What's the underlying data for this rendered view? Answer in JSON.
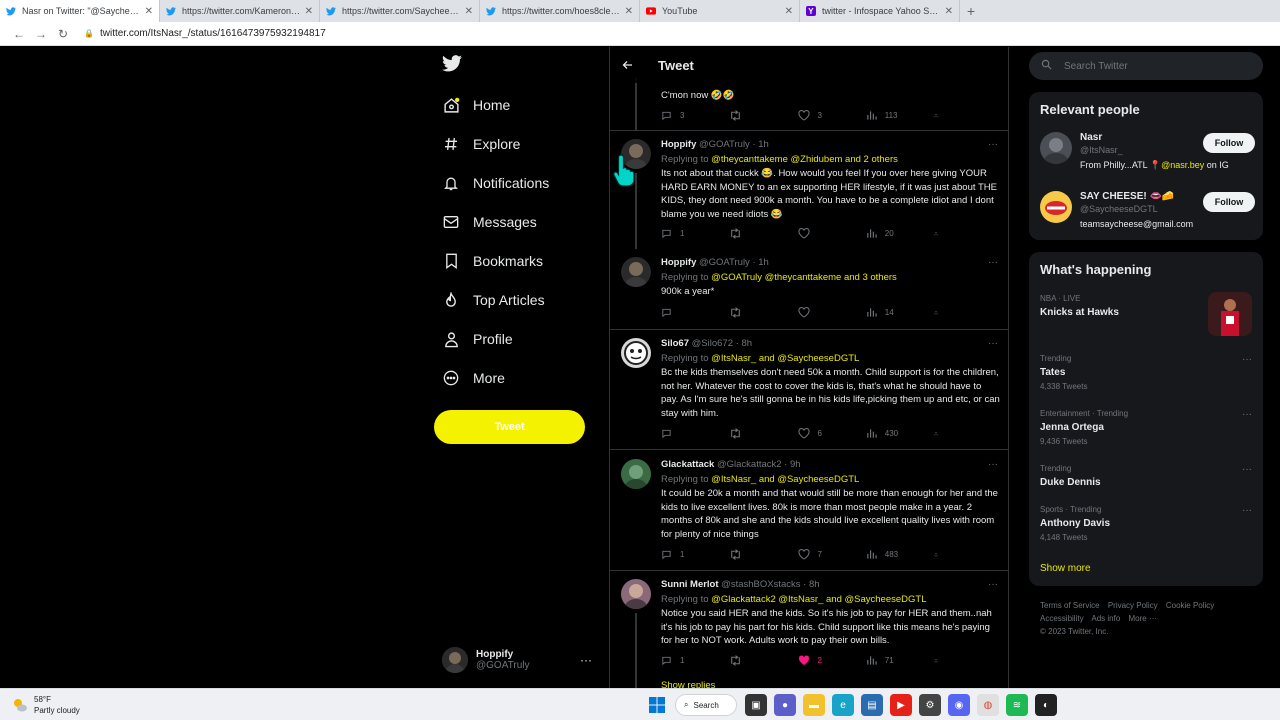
{
  "browser": {
    "tabs": [
      {
        "title": "Nasr on Twitter: \"@SaycheeseDGTL",
        "icon": "twitter-icon",
        "active": true
      },
      {
        "title": "https://twitter.com/KameronBen",
        "icon": "twitter-icon",
        "active": false
      },
      {
        "title": "https://twitter.com/SaycheeseDG",
        "icon": "twitter-icon",
        "active": false
      },
      {
        "title": "https://twitter.com/hoes8cleve/s",
        "icon": "twitter-icon",
        "active": false
      },
      {
        "title": "YouTube",
        "icon": "youtube-icon",
        "active": false
      },
      {
        "title": "twitter - Infospace Yahoo Search",
        "icon": "yahoo-icon",
        "active": false
      }
    ],
    "url": "twitter.com/ItsNasr_/status/1616473975932194817"
  },
  "nav": {
    "items": [
      {
        "label": "Home",
        "icon": "home-icon"
      },
      {
        "label": "Explore",
        "icon": "hashtag-icon"
      },
      {
        "label": "Notifications",
        "icon": "bell-icon"
      },
      {
        "label": "Messages",
        "icon": "envelope-icon"
      },
      {
        "label": "Bookmarks",
        "icon": "bookmark-icon"
      },
      {
        "label": "Top Articles",
        "icon": "fire-icon"
      },
      {
        "label": "Profile",
        "icon": "person-icon"
      },
      {
        "label": "More",
        "icon": "more-circle-icon"
      }
    ],
    "tweet_button": "Tweet",
    "account": {
      "name": "Hoppify",
      "handle": "@GOATruly"
    }
  },
  "header": {
    "title": "Tweet"
  },
  "tweets": [
    {
      "partial_text": "C'mon now 🤣🤣",
      "stats": {
        "replies": "3",
        "retweets": "",
        "likes": "3",
        "views": "113"
      }
    },
    {
      "name": "Hoppify",
      "handle": "@GOATruly",
      "time": "1h",
      "replying_label": "Replying to",
      "replying_to": "@theycanttakeme @Zhidubem and 2 others",
      "text": "Its not about that cuckk 😂. How would you feel If you over here giving YOUR HARD EARN MONEY to an ex supporting HER lifestyle, if it was just about THE KIDS, they dont need 900k a month. You have to be a complete idiot and I dont blame you we need idiots 😂",
      "stats": {
        "replies": "1",
        "retweets": "",
        "likes": "",
        "views": "20"
      }
    },
    {
      "name": "Hoppify",
      "handle": "@GOATruly",
      "time": "1h",
      "replying_label": "Replying to",
      "replying_to": "@GOATruly @theycanttakeme and 3 others",
      "text": "900k a year*",
      "stats": {
        "replies": "",
        "retweets": "",
        "likes": "",
        "views": "14"
      }
    },
    {
      "name": "Silo67",
      "handle": "@Silo672",
      "time": "8h",
      "replying_label": "Replying to",
      "replying_to": "@ItsNasr_ and @SaycheeseDGTL",
      "text": "Bc the kids themselves don't need 50k a month. Child support is for the children, not her. Whatever the cost to cover the kids is, that's what he should have to pay. As I'm sure he's still gonna be in his kids life,picking them up and etc, or can stay with him.",
      "stats": {
        "replies": "",
        "retweets": "",
        "likes": "6",
        "views": "430"
      }
    },
    {
      "name": "Glackattack",
      "handle": "@Glackattack2",
      "time": "9h",
      "replying_label": "Replying to",
      "replying_to": "@ItsNasr_ and @SaycheeseDGTL",
      "text": "It could be 20k a month and that would still be more than enough for her and the kids to live excellent lives. 80k is more than most people make in a year. 2 months of 80k and she and the kids should live excellent quality lives with room for plenty of nice things",
      "stats": {
        "replies": "1",
        "retweets": "",
        "likes": "7",
        "views": "483"
      }
    },
    {
      "name": "Sunni Merlot",
      "handle": "@stashBOXstacks",
      "time": "8h",
      "replying_label": "Replying to",
      "replying_to": "@Glackattack2 @ItsNasr_ and @SaycheeseDGTL",
      "text": "Notice you said HER and the kids. So it's his job to pay for HER and them..nah it's his job to pay his part for his kids. Child support like this means he's paying for her to NOT work. Adults work to pay their own bills.",
      "stats": {
        "replies": "1",
        "retweets": "",
        "likes": "2",
        "views": "71"
      }
    }
  ],
  "show_replies": "Show replies",
  "right": {
    "search_placeholder": "Search Twitter",
    "relevant_title": "Relevant people",
    "people": [
      {
        "name": "Nasr",
        "handle": "@ItsNasr_",
        "bio_pre": "From Philly...ATL 📍",
        "bio_link": "@nasr.bey",
        "bio_post": " on IG",
        "follow": "Follow"
      },
      {
        "name": "SAY CHEESE! 👄🧀",
        "handle": "@SaycheeseDGTL",
        "bio_pre": "teamsaycheese@gmail.com",
        "bio_link": "",
        "bio_post": "",
        "follow": "Follow"
      }
    ],
    "happening_title": "What's happening",
    "trends": [
      {
        "context": "NBA · LIVE",
        "name": "Knicks at Hawks",
        "count": ""
      },
      {
        "context": "Trending",
        "name": "Tates",
        "count": "4,338 Tweets"
      },
      {
        "context": "Entertainment · Trending",
        "name": "Jenna Ortega",
        "count": "9,436 Tweets"
      },
      {
        "context": "Trending",
        "name": "Duke Dennis",
        "count": ""
      },
      {
        "context": "Sports · Trending",
        "name": "Anthony Davis",
        "count": "4,148 Tweets"
      }
    ],
    "show_more": "Show more",
    "footer": [
      "Terms of Service",
      "Privacy Policy",
      "Cookie Policy",
      "Accessibility",
      "Ads info",
      "More ···",
      "© 2023 Twitter, Inc."
    ]
  },
  "taskbar": {
    "temp": "58°F",
    "weather": "Partly cloudy",
    "search": "Search"
  },
  "colors": {
    "accent": "#f5f200",
    "link": "#e8e800",
    "like_active": "#f91880"
  }
}
